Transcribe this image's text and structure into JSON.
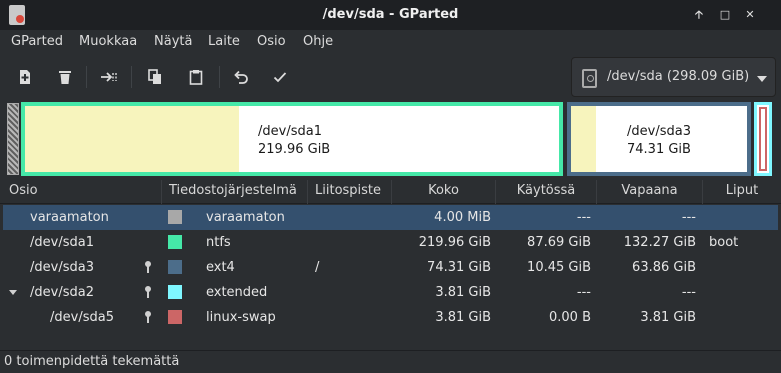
{
  "window": {
    "title": "/dev/sda - GParted",
    "buttons": [
      "minimize-icon",
      "maximize-icon",
      "close-icon"
    ],
    "minimize_glyph": "🡡",
    "maximize_glyph": "□",
    "close_glyph": "✕"
  },
  "menubar": {
    "items": [
      "GParted",
      "Muokkaa",
      "Näytä",
      "Laite",
      "Osio",
      "Ohje"
    ]
  },
  "toolbar": {
    "buttons": [
      "new-icon",
      "delete-icon",
      "resize-move-icon",
      "copy-icon",
      "paste-icon",
      "undo-icon",
      "apply-icon"
    ],
    "device_select": {
      "label": "/dev/sda   (298.09 GiB)"
    }
  },
  "diskmap": {
    "colors": {
      "ntfs": "#45e8a8",
      "ext4": "#4c6d8a",
      "extended": "#7ff7ff",
      "swap": "#cc6666",
      "used": "#f7f4bd"
    },
    "partitions": [
      {
        "name": "/dev/sda1",
        "size": "219.96 GiB",
        "used_fraction": 0.4
      },
      {
        "name": "/dev/sda3",
        "size": "74.31 GiB",
        "used_fraction": 0.14
      }
    ]
  },
  "table": {
    "headers": [
      "Osio",
      "Tiedostojärjestelmä",
      "Liitospiste",
      "Koko",
      "Käytössä",
      "Vapaana",
      "Liput"
    ],
    "rows": [
      {
        "partition": "varaamaton",
        "filesystem": "varaamaton",
        "mountpoint": "",
        "size": "4.00 MiB",
        "used": "---",
        "unused": "---",
        "flags": "",
        "color": "#a8a8a8",
        "locked": false,
        "selected": true
      },
      {
        "partition": "/dev/sda1",
        "filesystem": "ntfs",
        "mountpoint": "",
        "size": "219.96 GiB",
        "used": "87.69 GiB",
        "unused": "132.27 GiB",
        "flags": "boot",
        "color": "#45e8a8",
        "locked": false
      },
      {
        "partition": "/dev/sda3",
        "filesystem": "ext4",
        "mountpoint": "/",
        "size": "74.31 GiB",
        "used": "10.45 GiB",
        "unused": "63.86 GiB",
        "flags": "",
        "color": "#4c6d8a",
        "locked": true
      },
      {
        "partition": "/dev/sda2",
        "filesystem": "extended",
        "mountpoint": "",
        "size": "3.81 GiB",
        "used": "---",
        "unused": "---",
        "flags": "",
        "color": "#7ff7ff",
        "locked": true,
        "expanded": true
      },
      {
        "partition": "/dev/sda5",
        "filesystem": "linux-swap",
        "mountpoint": "",
        "size": "3.81 GiB",
        "used": "0.00 B",
        "unused": "3.81 GiB",
        "flags": "",
        "color": "#cc6666",
        "locked": true,
        "child": true
      }
    ]
  },
  "statusbar": {
    "text": "0 toimenpidettä tekemättä"
  }
}
